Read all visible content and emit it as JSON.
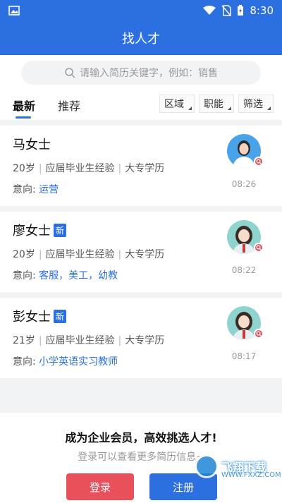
{
  "status_bar": {
    "time": "8:30"
  },
  "header": {
    "title": "找人才"
  },
  "search": {
    "placeholder": "请输入简历关键字，例如：销售"
  },
  "tabs": [
    {
      "label": "最新",
      "active": true
    },
    {
      "label": "推荐",
      "active": false
    }
  ],
  "filters": [
    {
      "label": "区域"
    },
    {
      "label": "职能"
    },
    {
      "label": "筛选"
    }
  ],
  "candidates": [
    {
      "name": "马女士",
      "is_new": false,
      "age": "20岁",
      "experience": "应届毕业生经验",
      "education": "大专学历",
      "intent_label": "意向:",
      "intent": "运营",
      "time": "08:26",
      "avatar": "photo-avatar"
    },
    {
      "name": "廖女士",
      "is_new": true,
      "badge": "新",
      "age": "20岁",
      "experience": "应届毕业生经验",
      "education": "大专学历",
      "intent_label": "意向:",
      "intent": "客服，美工，幼教",
      "time": "08:22",
      "avatar": "cartoon-avatar"
    },
    {
      "name": "彭女士",
      "is_new": true,
      "badge": "新",
      "age": "21岁",
      "experience": "应届毕业生经验",
      "education": "大专学历",
      "intent_label": "意向:",
      "intent": "小学英语实习教师",
      "time": "08:17",
      "avatar": "cartoon-avatar"
    }
  ],
  "promo": {
    "title": "成为企业会员，高效挑选人才!",
    "subtitle": "登录可以查看更多简历信息~",
    "login_label": "登录",
    "register_label": "注册"
  },
  "watermark": {
    "text": "飞翔下载",
    "url": "WWW.FXXZ.COM"
  },
  "colors": {
    "primary": "#2b6fe0",
    "accent": "#e8505b"
  }
}
